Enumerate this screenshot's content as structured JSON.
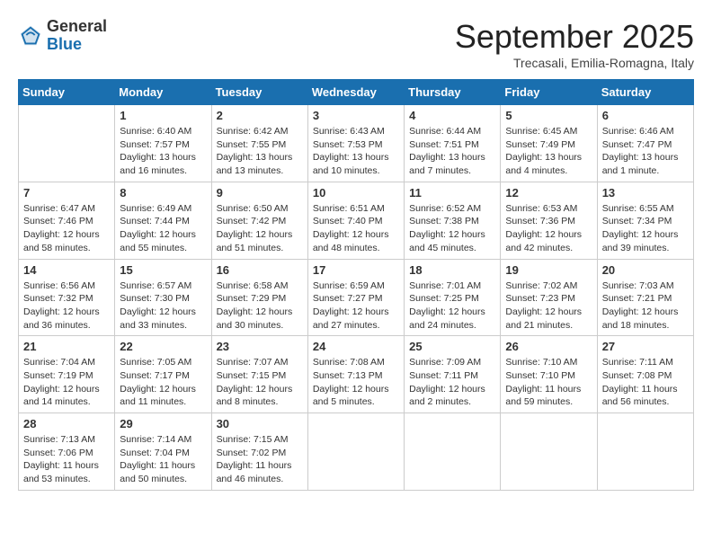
{
  "logo": {
    "general": "General",
    "blue": "Blue"
  },
  "title": "September 2025",
  "subtitle": "Trecasali, Emilia-Romagna, Italy",
  "days_of_week": [
    "Sunday",
    "Monday",
    "Tuesday",
    "Wednesday",
    "Thursday",
    "Friday",
    "Saturday"
  ],
  "weeks": [
    [
      {
        "day": "",
        "sunrise": "",
        "sunset": "",
        "daylight": ""
      },
      {
        "day": "1",
        "sunrise": "Sunrise: 6:40 AM",
        "sunset": "Sunset: 7:57 PM",
        "daylight": "Daylight: 13 hours and 16 minutes."
      },
      {
        "day": "2",
        "sunrise": "Sunrise: 6:42 AM",
        "sunset": "Sunset: 7:55 PM",
        "daylight": "Daylight: 13 hours and 13 minutes."
      },
      {
        "day": "3",
        "sunrise": "Sunrise: 6:43 AM",
        "sunset": "Sunset: 7:53 PM",
        "daylight": "Daylight: 13 hours and 10 minutes."
      },
      {
        "day": "4",
        "sunrise": "Sunrise: 6:44 AM",
        "sunset": "Sunset: 7:51 PM",
        "daylight": "Daylight: 13 hours and 7 minutes."
      },
      {
        "day": "5",
        "sunrise": "Sunrise: 6:45 AM",
        "sunset": "Sunset: 7:49 PM",
        "daylight": "Daylight: 13 hours and 4 minutes."
      },
      {
        "day": "6",
        "sunrise": "Sunrise: 6:46 AM",
        "sunset": "Sunset: 7:47 PM",
        "daylight": "Daylight: 13 hours and 1 minute."
      }
    ],
    [
      {
        "day": "7",
        "sunrise": "Sunrise: 6:47 AM",
        "sunset": "Sunset: 7:46 PM",
        "daylight": "Daylight: 12 hours and 58 minutes."
      },
      {
        "day": "8",
        "sunrise": "Sunrise: 6:49 AM",
        "sunset": "Sunset: 7:44 PM",
        "daylight": "Daylight: 12 hours and 55 minutes."
      },
      {
        "day": "9",
        "sunrise": "Sunrise: 6:50 AM",
        "sunset": "Sunset: 7:42 PM",
        "daylight": "Daylight: 12 hours and 51 minutes."
      },
      {
        "day": "10",
        "sunrise": "Sunrise: 6:51 AM",
        "sunset": "Sunset: 7:40 PM",
        "daylight": "Daylight: 12 hours and 48 minutes."
      },
      {
        "day": "11",
        "sunrise": "Sunrise: 6:52 AM",
        "sunset": "Sunset: 7:38 PM",
        "daylight": "Daylight: 12 hours and 45 minutes."
      },
      {
        "day": "12",
        "sunrise": "Sunrise: 6:53 AM",
        "sunset": "Sunset: 7:36 PM",
        "daylight": "Daylight: 12 hours and 42 minutes."
      },
      {
        "day": "13",
        "sunrise": "Sunrise: 6:55 AM",
        "sunset": "Sunset: 7:34 PM",
        "daylight": "Daylight: 12 hours and 39 minutes."
      }
    ],
    [
      {
        "day": "14",
        "sunrise": "Sunrise: 6:56 AM",
        "sunset": "Sunset: 7:32 PM",
        "daylight": "Daylight: 12 hours and 36 minutes."
      },
      {
        "day": "15",
        "sunrise": "Sunrise: 6:57 AM",
        "sunset": "Sunset: 7:30 PM",
        "daylight": "Daylight: 12 hours and 33 minutes."
      },
      {
        "day": "16",
        "sunrise": "Sunrise: 6:58 AM",
        "sunset": "Sunset: 7:29 PM",
        "daylight": "Daylight: 12 hours and 30 minutes."
      },
      {
        "day": "17",
        "sunrise": "Sunrise: 6:59 AM",
        "sunset": "Sunset: 7:27 PM",
        "daylight": "Daylight: 12 hours and 27 minutes."
      },
      {
        "day": "18",
        "sunrise": "Sunrise: 7:01 AM",
        "sunset": "Sunset: 7:25 PM",
        "daylight": "Daylight: 12 hours and 24 minutes."
      },
      {
        "day": "19",
        "sunrise": "Sunrise: 7:02 AM",
        "sunset": "Sunset: 7:23 PM",
        "daylight": "Daylight: 12 hours and 21 minutes."
      },
      {
        "day": "20",
        "sunrise": "Sunrise: 7:03 AM",
        "sunset": "Sunset: 7:21 PM",
        "daylight": "Daylight: 12 hours and 18 minutes."
      }
    ],
    [
      {
        "day": "21",
        "sunrise": "Sunrise: 7:04 AM",
        "sunset": "Sunset: 7:19 PM",
        "daylight": "Daylight: 12 hours and 14 minutes."
      },
      {
        "day": "22",
        "sunrise": "Sunrise: 7:05 AM",
        "sunset": "Sunset: 7:17 PM",
        "daylight": "Daylight: 12 hours and 11 minutes."
      },
      {
        "day": "23",
        "sunrise": "Sunrise: 7:07 AM",
        "sunset": "Sunset: 7:15 PM",
        "daylight": "Daylight: 12 hours and 8 minutes."
      },
      {
        "day": "24",
        "sunrise": "Sunrise: 7:08 AM",
        "sunset": "Sunset: 7:13 PM",
        "daylight": "Daylight: 12 hours and 5 minutes."
      },
      {
        "day": "25",
        "sunrise": "Sunrise: 7:09 AM",
        "sunset": "Sunset: 7:11 PM",
        "daylight": "Daylight: 12 hours and 2 minutes."
      },
      {
        "day": "26",
        "sunrise": "Sunrise: 7:10 AM",
        "sunset": "Sunset: 7:10 PM",
        "daylight": "Daylight: 11 hours and 59 minutes."
      },
      {
        "day": "27",
        "sunrise": "Sunrise: 7:11 AM",
        "sunset": "Sunset: 7:08 PM",
        "daylight": "Daylight: 11 hours and 56 minutes."
      }
    ],
    [
      {
        "day": "28",
        "sunrise": "Sunrise: 7:13 AM",
        "sunset": "Sunset: 7:06 PM",
        "daylight": "Daylight: 11 hours and 53 minutes."
      },
      {
        "day": "29",
        "sunrise": "Sunrise: 7:14 AM",
        "sunset": "Sunset: 7:04 PM",
        "daylight": "Daylight: 11 hours and 50 minutes."
      },
      {
        "day": "30",
        "sunrise": "Sunrise: 7:15 AM",
        "sunset": "Sunset: 7:02 PM",
        "daylight": "Daylight: 11 hours and 46 minutes."
      },
      {
        "day": "",
        "sunrise": "",
        "sunset": "",
        "daylight": ""
      },
      {
        "day": "",
        "sunrise": "",
        "sunset": "",
        "daylight": ""
      },
      {
        "day": "",
        "sunrise": "",
        "sunset": "",
        "daylight": ""
      },
      {
        "day": "",
        "sunrise": "",
        "sunset": "",
        "daylight": ""
      }
    ]
  ]
}
